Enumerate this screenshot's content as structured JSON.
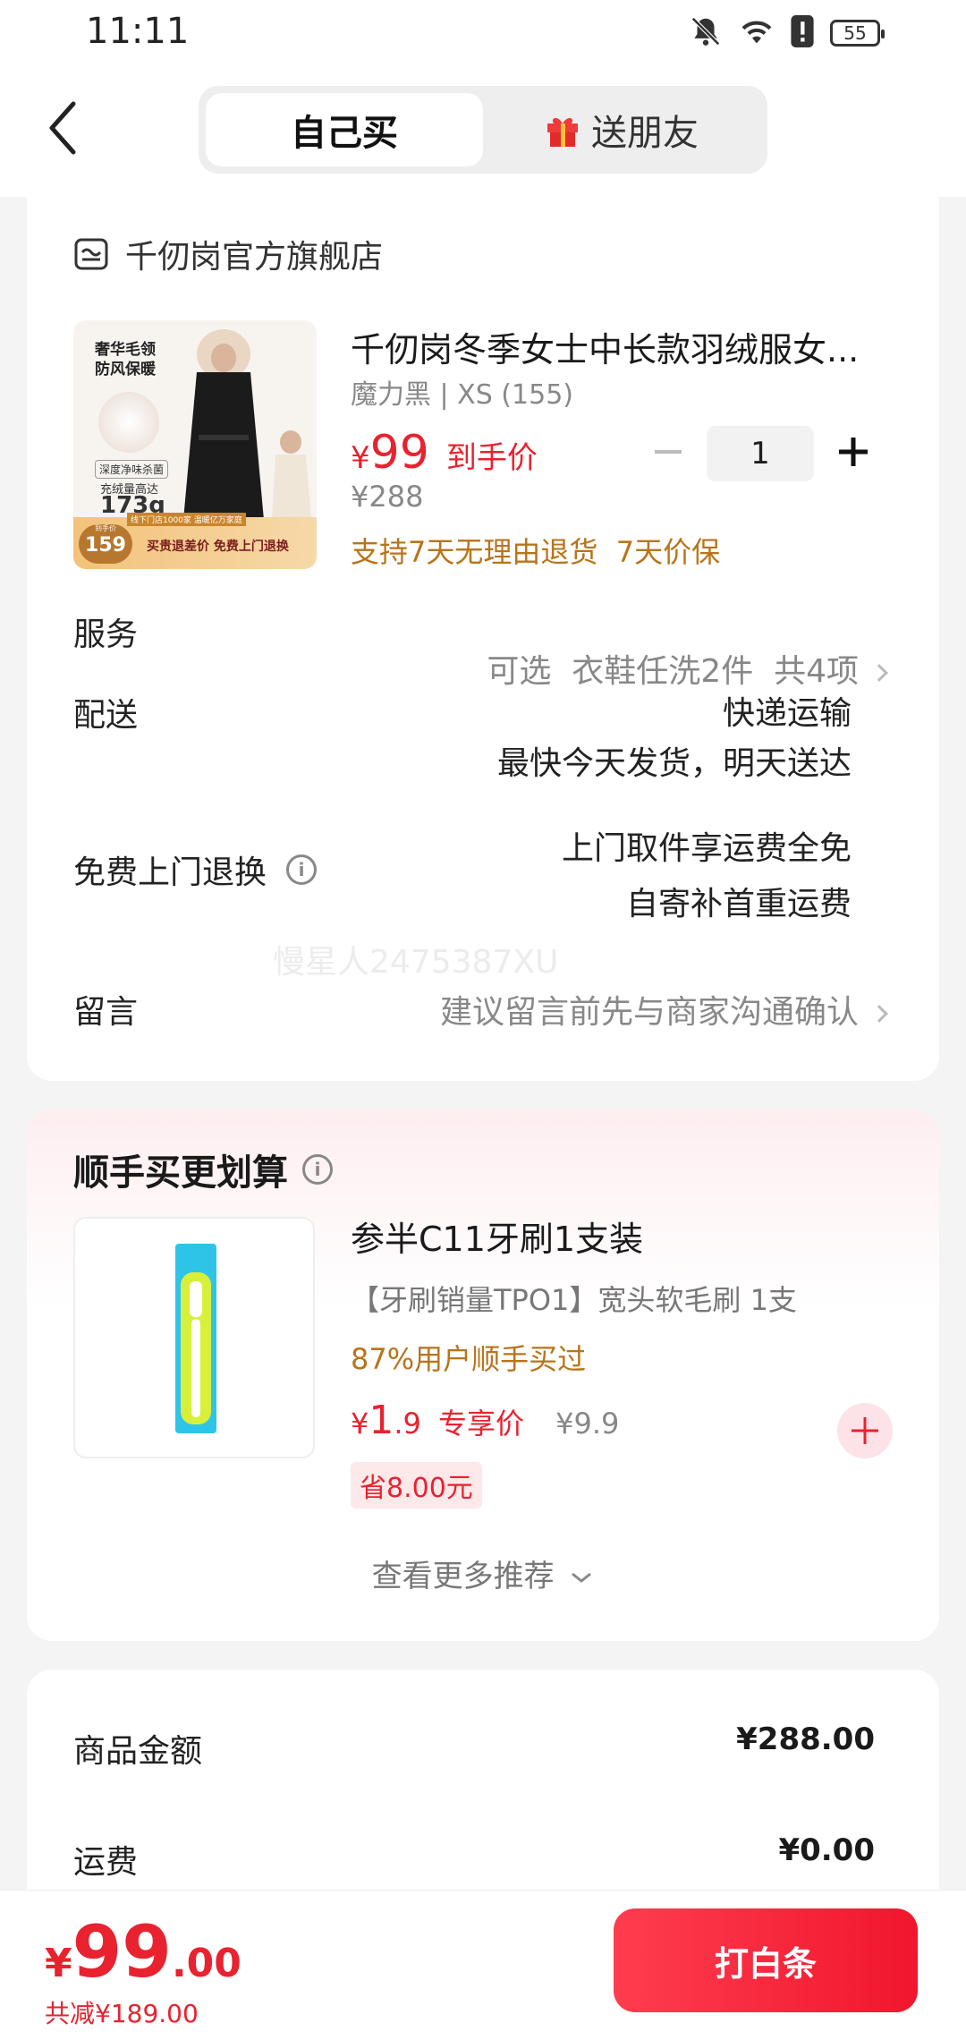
{
  "status_bar": {
    "time": "11:11",
    "battery": "55"
  },
  "header": {
    "tab_self": "自己买",
    "tab_gift": "送朋友"
  },
  "store": {
    "name": "千仞岗官方旗舰店"
  },
  "product": {
    "title": "千仞岗冬季女士中长款羽绒服女...",
    "variant": "魔力黑 | XS (155)",
    "price_symbol": "¥",
    "price": "99",
    "price_tag": "到手价",
    "original_price": "¥288",
    "quantity": "1",
    "guarantee": "支持7天无理由退货  7天价保",
    "image_texts": {
      "tag1": "奢华毛领",
      "tag2": "防风保暖",
      "tag3": "深度净味杀菌",
      "tag4": "充绒量高达",
      "weight": "173g",
      "store_line": "线下门店1000家 温暖亿万家庭",
      "price_label": "到手价",
      "price": "159",
      "promo": "买贵退差价 免费上门退换"
    }
  },
  "rows": {
    "service_label": "服务",
    "service_value": "可选  衣鞋任洗2件  共4项",
    "delivery_label": "配送",
    "delivery_line1": "快递运输",
    "delivery_line2": "最快今天发货，明天送达",
    "return_label": "免费上门退换",
    "return_line1": "上门取件享运费全免",
    "return_line2": "自寄补首重运费",
    "message_label": "留言",
    "message_placeholder": "建议留言前先与商家沟通确认"
  },
  "watermark": "慢星人2475387XU",
  "addon": {
    "section_title": "顺手买更划算",
    "title": "参半C11牙刷1支装",
    "desc": "【牙刷销量TPO1】宽头软毛刷 1支",
    "social": "87%用户顺手买过",
    "price_symbol": "¥",
    "price_int": "1",
    "price_dec": ".9",
    "price_tag": "专享价",
    "original_price": "¥9.9",
    "save": "省8.00元",
    "more": "查看更多推荐"
  },
  "summary": {
    "goods_label": "商品金额",
    "goods_value": "¥288.00",
    "shipping_label": "运费",
    "shipping_value": "¥0.00"
  },
  "bottom": {
    "symbol": "¥",
    "total_int": "99",
    "total_dec": ".00",
    "discount": "共减¥189.00",
    "pay_button": "打白条"
  },
  "colors": {
    "accent": "#e8222f",
    "orange": "#b8741a",
    "gray": "#888888"
  }
}
